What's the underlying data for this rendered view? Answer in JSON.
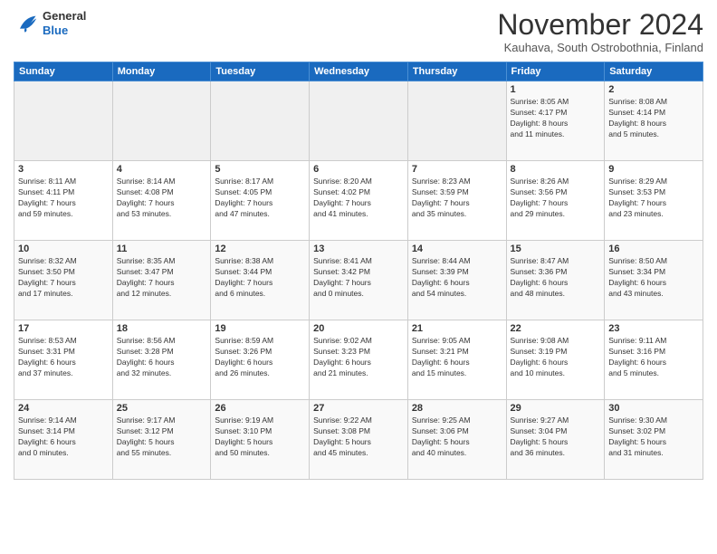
{
  "header": {
    "logo_general": "General",
    "logo_blue": "Blue",
    "month_title": "November 2024",
    "location": "Kauhava, South Ostrobothnia, Finland"
  },
  "weekdays": [
    "Sunday",
    "Monday",
    "Tuesday",
    "Wednesday",
    "Thursday",
    "Friday",
    "Saturday"
  ],
  "weeks": [
    [
      {
        "day": "",
        "info": ""
      },
      {
        "day": "",
        "info": ""
      },
      {
        "day": "",
        "info": ""
      },
      {
        "day": "",
        "info": ""
      },
      {
        "day": "",
        "info": ""
      },
      {
        "day": "1",
        "info": "Sunrise: 8:05 AM\nSunset: 4:17 PM\nDaylight: 8 hours\nand 11 minutes."
      },
      {
        "day": "2",
        "info": "Sunrise: 8:08 AM\nSunset: 4:14 PM\nDaylight: 8 hours\nand 5 minutes."
      }
    ],
    [
      {
        "day": "3",
        "info": "Sunrise: 8:11 AM\nSunset: 4:11 PM\nDaylight: 7 hours\nand 59 minutes."
      },
      {
        "day": "4",
        "info": "Sunrise: 8:14 AM\nSunset: 4:08 PM\nDaylight: 7 hours\nand 53 minutes."
      },
      {
        "day": "5",
        "info": "Sunrise: 8:17 AM\nSunset: 4:05 PM\nDaylight: 7 hours\nand 47 minutes."
      },
      {
        "day": "6",
        "info": "Sunrise: 8:20 AM\nSunset: 4:02 PM\nDaylight: 7 hours\nand 41 minutes."
      },
      {
        "day": "7",
        "info": "Sunrise: 8:23 AM\nSunset: 3:59 PM\nDaylight: 7 hours\nand 35 minutes."
      },
      {
        "day": "8",
        "info": "Sunrise: 8:26 AM\nSunset: 3:56 PM\nDaylight: 7 hours\nand 29 minutes."
      },
      {
        "day": "9",
        "info": "Sunrise: 8:29 AM\nSunset: 3:53 PM\nDaylight: 7 hours\nand 23 minutes."
      }
    ],
    [
      {
        "day": "10",
        "info": "Sunrise: 8:32 AM\nSunset: 3:50 PM\nDaylight: 7 hours\nand 17 minutes."
      },
      {
        "day": "11",
        "info": "Sunrise: 8:35 AM\nSunset: 3:47 PM\nDaylight: 7 hours\nand 12 minutes."
      },
      {
        "day": "12",
        "info": "Sunrise: 8:38 AM\nSunset: 3:44 PM\nDaylight: 7 hours\nand 6 minutes."
      },
      {
        "day": "13",
        "info": "Sunrise: 8:41 AM\nSunset: 3:42 PM\nDaylight: 7 hours\nand 0 minutes."
      },
      {
        "day": "14",
        "info": "Sunrise: 8:44 AM\nSunset: 3:39 PM\nDaylight: 6 hours\nand 54 minutes."
      },
      {
        "day": "15",
        "info": "Sunrise: 8:47 AM\nSunset: 3:36 PM\nDaylight: 6 hours\nand 48 minutes."
      },
      {
        "day": "16",
        "info": "Sunrise: 8:50 AM\nSunset: 3:34 PM\nDaylight: 6 hours\nand 43 minutes."
      }
    ],
    [
      {
        "day": "17",
        "info": "Sunrise: 8:53 AM\nSunset: 3:31 PM\nDaylight: 6 hours\nand 37 minutes."
      },
      {
        "day": "18",
        "info": "Sunrise: 8:56 AM\nSunset: 3:28 PM\nDaylight: 6 hours\nand 32 minutes."
      },
      {
        "day": "19",
        "info": "Sunrise: 8:59 AM\nSunset: 3:26 PM\nDaylight: 6 hours\nand 26 minutes."
      },
      {
        "day": "20",
        "info": "Sunrise: 9:02 AM\nSunset: 3:23 PM\nDaylight: 6 hours\nand 21 minutes."
      },
      {
        "day": "21",
        "info": "Sunrise: 9:05 AM\nSunset: 3:21 PM\nDaylight: 6 hours\nand 15 minutes."
      },
      {
        "day": "22",
        "info": "Sunrise: 9:08 AM\nSunset: 3:19 PM\nDaylight: 6 hours\nand 10 minutes."
      },
      {
        "day": "23",
        "info": "Sunrise: 9:11 AM\nSunset: 3:16 PM\nDaylight: 6 hours\nand 5 minutes."
      }
    ],
    [
      {
        "day": "24",
        "info": "Sunrise: 9:14 AM\nSunset: 3:14 PM\nDaylight: 6 hours\nand 0 minutes."
      },
      {
        "day": "25",
        "info": "Sunrise: 9:17 AM\nSunset: 3:12 PM\nDaylight: 5 hours\nand 55 minutes."
      },
      {
        "day": "26",
        "info": "Sunrise: 9:19 AM\nSunset: 3:10 PM\nDaylight: 5 hours\nand 50 minutes."
      },
      {
        "day": "27",
        "info": "Sunrise: 9:22 AM\nSunset: 3:08 PM\nDaylight: 5 hours\nand 45 minutes."
      },
      {
        "day": "28",
        "info": "Sunrise: 9:25 AM\nSunset: 3:06 PM\nDaylight: 5 hours\nand 40 minutes."
      },
      {
        "day": "29",
        "info": "Sunrise: 9:27 AM\nSunset: 3:04 PM\nDaylight: 5 hours\nand 36 minutes."
      },
      {
        "day": "30",
        "info": "Sunrise: 9:30 AM\nSunset: 3:02 PM\nDaylight: 5 hours\nand 31 minutes."
      }
    ]
  ]
}
